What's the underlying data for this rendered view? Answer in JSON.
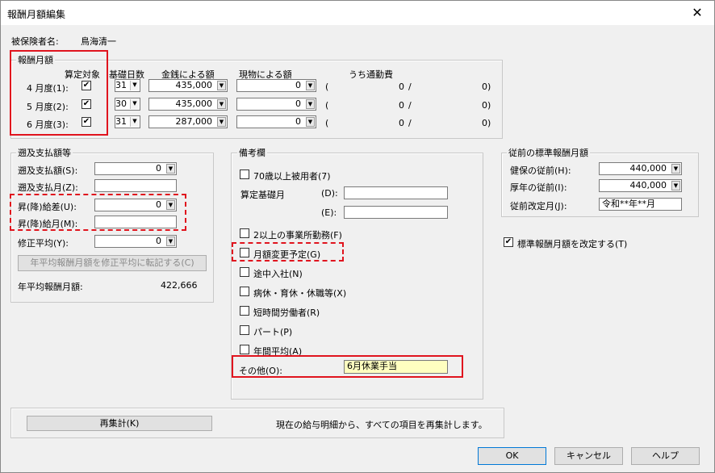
{
  "window": {
    "title": "報酬月額編集",
    "close_glyph": "✕"
  },
  "insured": {
    "label": "被保険者名:",
    "name": "鳥海清一"
  },
  "monthly": {
    "group_label": "報酬月額",
    "headers": {
      "target": "算定対象",
      "days": "基礎日数",
      "money": "金銭による額",
      "kind": "現物による額",
      "commute": "うち通勤費"
    },
    "rows": [
      {
        "label": "4 月度(1):",
        "checked": true,
        "days": "31",
        "money": "435,000",
        "kind": "0",
        "paren_open": "(",
        "commute_a": "0",
        "slash": "/",
        "commute_b": "0)"
      },
      {
        "label": "5 月度(2):",
        "checked": true,
        "days": "30",
        "money": "435,000",
        "kind": "0",
        "paren_open": "(",
        "commute_a": "0",
        "slash": "/",
        "commute_b": "0)"
      },
      {
        "label": "6 月度(3):",
        "checked": true,
        "days": "31",
        "money": "287,000",
        "kind": "0",
        "paren_open": "(",
        "commute_a": "0",
        "slash": "/",
        "commute_b": "0)"
      }
    ]
  },
  "retro": {
    "group_label": "遡及支払額等",
    "amount_label": "遡及支払額(S):",
    "amount_value": "0",
    "month_label": "遡及支払月(Z):",
    "month_value": "",
    "raise_diff_label": "昇(降)給差(U):",
    "raise_diff_value": "0",
    "raise_month_label": "昇(降)給月(M):",
    "raise_month_value": "",
    "revised_label": "修正平均(Y):",
    "revised_value": "0",
    "transfer_button": "年平均報酬月額を修正平均に転記する(C)",
    "annual_label": "年平均報酬月額:",
    "annual_value": "422,666"
  },
  "remarks": {
    "group_label": "備考欄",
    "over70": "70歳以上被用者(7)",
    "calc_month_label": "算定基礎月",
    "d_label": "(D):",
    "e_label": "(E):",
    "multi_office": "2以上の事業所勤務(F)",
    "change_plan": "月額変更予定(G)",
    "mid_join": "途中入社(N)",
    "leave": "病休・育休・休職等(X)",
    "short_time": "短時間労働者(R)",
    "part": "パート(P)",
    "annual_avg": "年間平均(A)",
    "other_label": "その他(O):",
    "other_value": "6月休業手当"
  },
  "previous": {
    "group_label": "従前の標準報酬月額",
    "health_label": "健保の従前(H):",
    "health_value": "440,000",
    "pension_label": "厚年の従前(I):",
    "pension_value": "440,000",
    "revise_month_label": "従前改定月(J):",
    "revise_month_value": "令和**年**月"
  },
  "revise_standard": {
    "label": "標準報酬月額を改定する(T)",
    "checked": true
  },
  "recalc": {
    "button": "再集計(K)",
    "description": "現在の給与明細から、すべての項目を再集計します。"
  },
  "footer": {
    "ok": "OK",
    "cancel": "キャンセル",
    "help": "ヘルプ"
  },
  "annotation_color": "#e0141e",
  "highlight_color": "#ffffc0"
}
